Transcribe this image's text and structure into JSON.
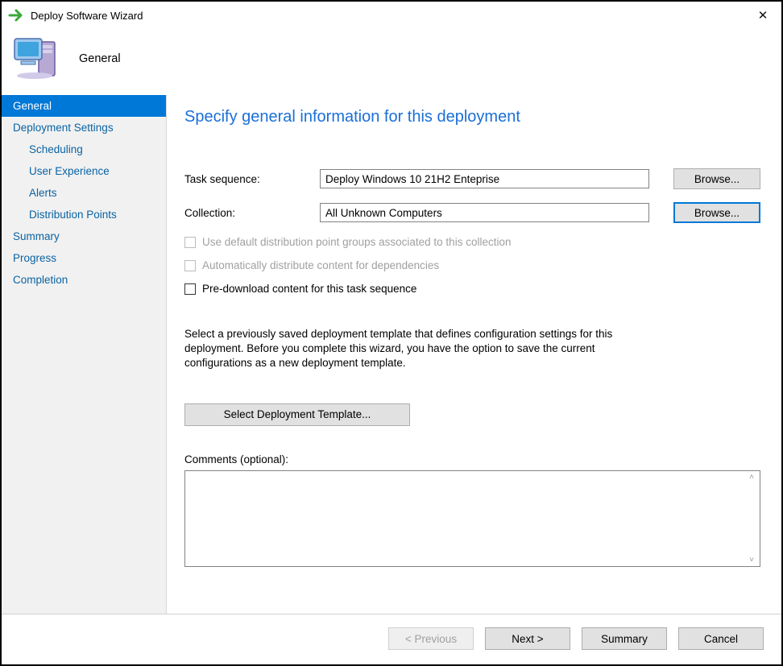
{
  "window": {
    "title": "Deploy Software Wizard",
    "close_glyph": "✕"
  },
  "header": {
    "section": "General"
  },
  "sidebar": {
    "items": [
      {
        "label": "General",
        "indent": false,
        "active": true
      },
      {
        "label": "Deployment Settings",
        "indent": false,
        "active": false
      },
      {
        "label": "Scheduling",
        "indent": true,
        "active": false
      },
      {
        "label": "User Experience",
        "indent": true,
        "active": false
      },
      {
        "label": "Alerts",
        "indent": true,
        "active": false
      },
      {
        "label": "Distribution Points",
        "indent": true,
        "active": false
      },
      {
        "label": "Summary",
        "indent": false,
        "active": false
      },
      {
        "label": "Progress",
        "indent": false,
        "active": false
      },
      {
        "label": "Completion",
        "indent": false,
        "active": false
      }
    ]
  },
  "main": {
    "heading": "Specify general information for this deployment",
    "task_sequence_label": "Task sequence:",
    "task_sequence_value": "Deploy Windows 10 21H2 Enteprise",
    "collection_label": "Collection:",
    "collection_value": "All Unknown Computers",
    "browse_label": "Browse...",
    "cb_use_default": "Use default distribution point groups associated to this collection",
    "cb_auto_distribute": "Automatically distribute content for dependencies",
    "cb_predownload": "Pre-download content for this task sequence",
    "template_explain": "Select a previously saved deployment template that defines configuration settings for this deployment. Before you complete this wizard, you have the option to save the current configurations as a new deployment template.",
    "template_button": "Select Deployment Template...",
    "comments_label": "Comments (optional):",
    "comments_value": ""
  },
  "footer": {
    "previous": "< Previous",
    "next": "Next >",
    "summary": "Summary",
    "cancel": "Cancel"
  }
}
